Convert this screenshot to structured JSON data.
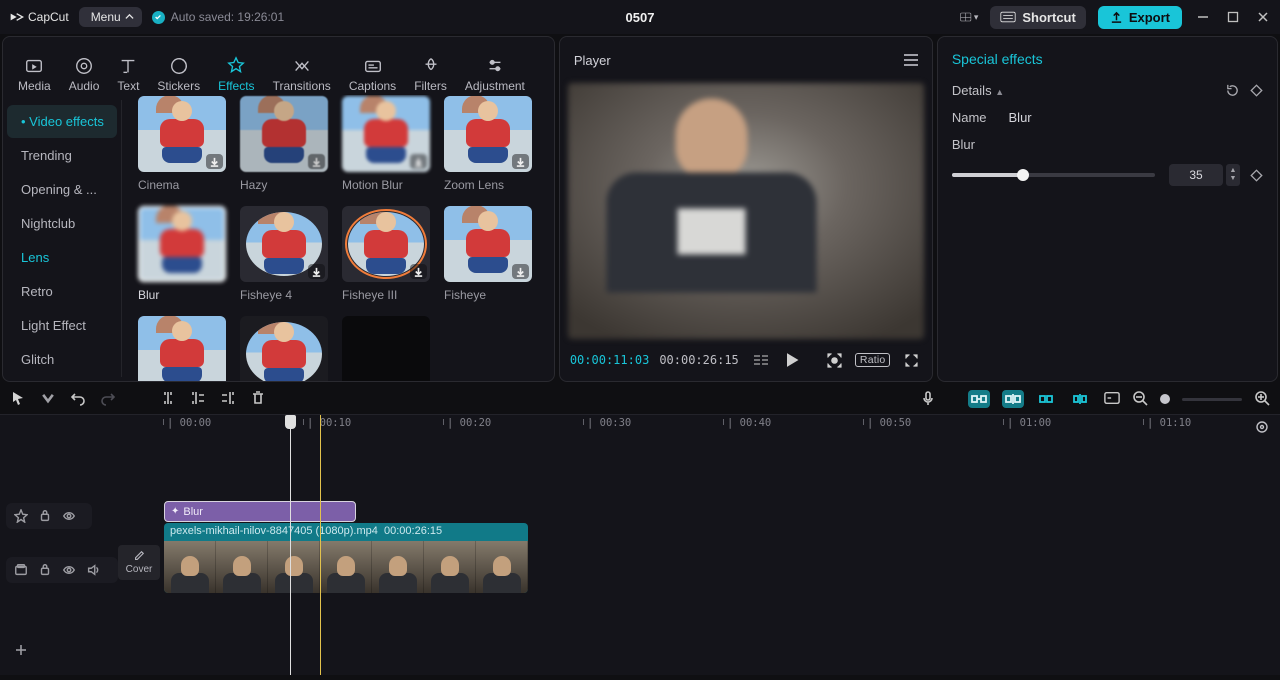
{
  "titlebar": {
    "app": "CapCut",
    "menu": "Menu",
    "autosave": "Auto saved: 19:26:01",
    "project": "0507",
    "shortcut": "Shortcut",
    "export": "Export"
  },
  "modules": [
    "Media",
    "Audio",
    "Text",
    "Stickers",
    "Effects",
    "Transitions",
    "Captions",
    "Filters",
    "Adjustment"
  ],
  "modules_active": 4,
  "categories": [
    "Video effects",
    "Trending",
    "Opening & ...",
    "Nightclub",
    "Lens",
    "Retro",
    "Light Effect",
    "Glitch"
  ],
  "categories_selected": 0,
  "categories_active": 4,
  "effects": [
    {
      "name": "Cinema",
      "dl": true
    },
    {
      "name": "Hazy",
      "dl": true
    },
    {
      "name": "Motion Blur",
      "dl": true
    },
    {
      "name": "Zoom Lens",
      "dl": true
    },
    {
      "name": "Blur",
      "dl": false,
      "sel": true
    },
    {
      "name": "Fisheye 4",
      "dl": true,
      "circle": true
    },
    {
      "name": "Fisheye III",
      "dl": true,
      "circle": true,
      "ring": true
    },
    {
      "name": "Fisheye",
      "dl": true
    },
    {
      "name": "",
      "dl": false
    },
    {
      "name": "",
      "dl": false,
      "circle": true,
      "dark": true
    },
    {
      "name": "",
      "dl": false,
      "black": true
    }
  ],
  "player": {
    "title": "Player",
    "current": "00:00:11:03",
    "total": "00:00:26:15",
    "ratio": "Ratio"
  },
  "inspector": {
    "title": "Special effects",
    "details": "Details",
    "nameLabel": "Name",
    "nameValue": "Blur",
    "sliderLabel": "Blur",
    "sliderValue": "35"
  },
  "ruler": [
    "00:00",
    "00:10",
    "00:20",
    "00:30",
    "00:40",
    "00:50",
    "01:00",
    "01:10"
  ],
  "timeline": {
    "fxName": "Blur",
    "videoName": "pexels-mikhail-nilov-8847405 (1080p).mp4",
    "videoDur": "00:00:26:15",
    "cover": "Cover"
  }
}
